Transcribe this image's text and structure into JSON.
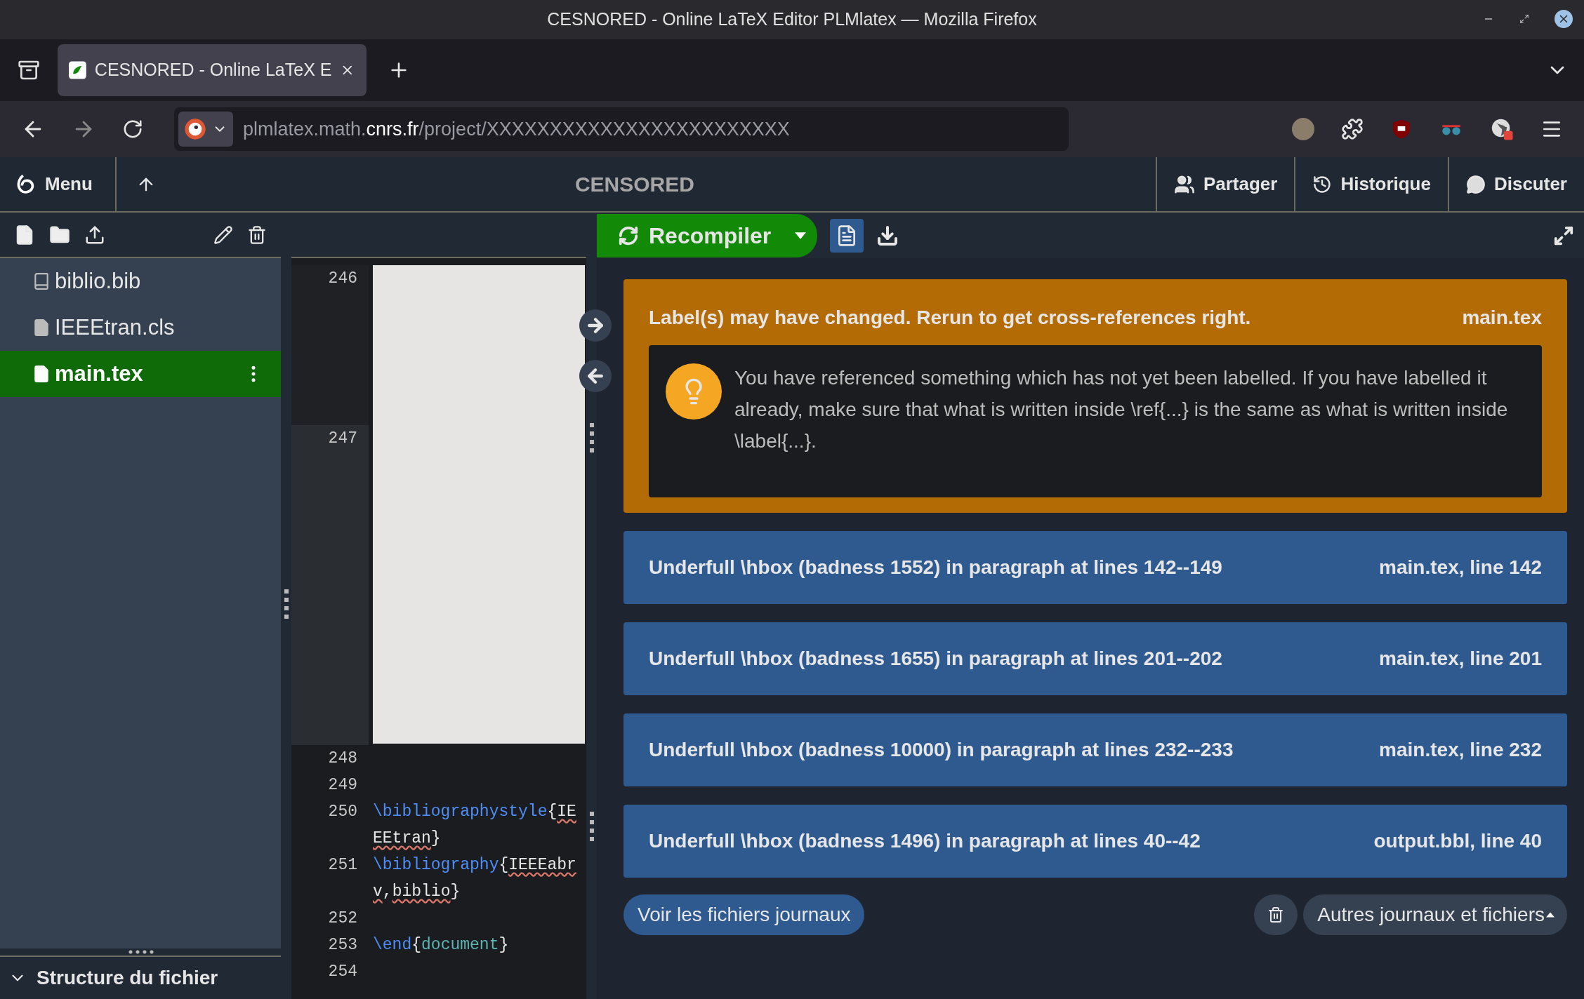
{
  "window": {
    "title": "CESNORED - Online LaTeX Editor PLMlatex — Mozilla Firefox"
  },
  "browser": {
    "tab": {
      "title": "CESNORED - Online LaTeX E",
      "selected": true
    },
    "url": {
      "prefix": "plmlatex.math.",
      "domain": "cnrs.fr",
      "path": "/project/XXXXXXXXXXXXXXXXXXXXXXXX"
    }
  },
  "header": {
    "menu": "Menu",
    "project_title": "CENSORED",
    "actions": [
      {
        "label": "Partager",
        "kind": "share"
      },
      {
        "label": "Historique",
        "kind": "history"
      },
      {
        "label": "Discuter",
        "kind": "chat"
      }
    ]
  },
  "files": [
    {
      "name": "biblio.bib",
      "kind": "bib",
      "selected": false
    },
    {
      "name": "IEEEtran.cls",
      "kind": "file",
      "selected": false
    },
    {
      "name": "main.tex",
      "kind": "file",
      "selected": true
    }
  ],
  "outline": {
    "title": "Structure du fichier"
  },
  "editor": {
    "lines": [
      {
        "number": "246"
      },
      {
        "number": "247"
      },
      {
        "number": "248"
      },
      {
        "number": "249"
      },
      {
        "number": "250",
        "tokens": [
          {
            "text": "\\bibliographystyle",
            "kind": "command"
          },
          {
            "text": "{",
            "kind": "plain"
          },
          {
            "text": "IE",
            "kind": "misspelled"
          }
        ],
        "wrap": [
          {
            "text": "EEtran",
            "kind": "misspelled"
          },
          {
            "text": "}",
            "kind": "plain"
          }
        ]
      },
      {
        "number": "251",
        "tokens": [
          {
            "text": "\\bibliography",
            "kind": "command"
          },
          {
            "text": "{",
            "kind": "plain"
          },
          {
            "text": "IEEEabr",
            "kind": "misspelled"
          }
        ],
        "wrap": [
          {
            "text": "v",
            "kind": "misspelled"
          },
          {
            "text": ",",
            "kind": "plain"
          },
          {
            "text": "biblio",
            "kind": "misspelled"
          },
          {
            "text": "}",
            "kind": "plain"
          }
        ]
      },
      {
        "number": "252"
      },
      {
        "number": "253",
        "tokens": [
          {
            "text": "\\end",
            "kind": "command"
          },
          {
            "text": "{",
            "kind": "plain"
          },
          {
            "text": "document",
            "kind": "keyword"
          },
          {
            "text": "}",
            "kind": "plain"
          }
        ]
      },
      {
        "number": "254"
      }
    ]
  },
  "pdf_toolbar": {
    "recompile": "Recompiler"
  },
  "logs": [
    {
      "color": "#b36b05",
      "title": "Label(s) may have changed. Rerun to get cross-references right.",
      "location": "main.tex",
      "hint": "You have referenced something which has not yet been labelled. If you have labelled it already, make sure that what is written inside \\ref{...} is the same as what is written inside \\label{...}."
    },
    {
      "color": "#2e5a90",
      "title": "Underfull \\hbox (badness 1552) in paragraph at lines 142--149",
      "location": "main.tex, line 142"
    },
    {
      "color": "#2e5a90",
      "title": "Underfull \\hbox (badness 1655) in paragraph at lines 201--202",
      "location": "main.tex, line 201"
    },
    {
      "color": "#2e5a90",
      "title": "Underfull \\hbox (badness 10000) in paragraph at lines 232--233",
      "location": "main.tex, line 232"
    },
    {
      "color": "#2e5a90",
      "title": "Underfull \\hbox (badness 1496) in paragraph at lines 40--42",
      "location": "output.bbl, line 40"
    }
  ],
  "log_buttons": {
    "view_raw": "Voir les fichiers journaux",
    "other": "Autres journaux et fichiers"
  }
}
